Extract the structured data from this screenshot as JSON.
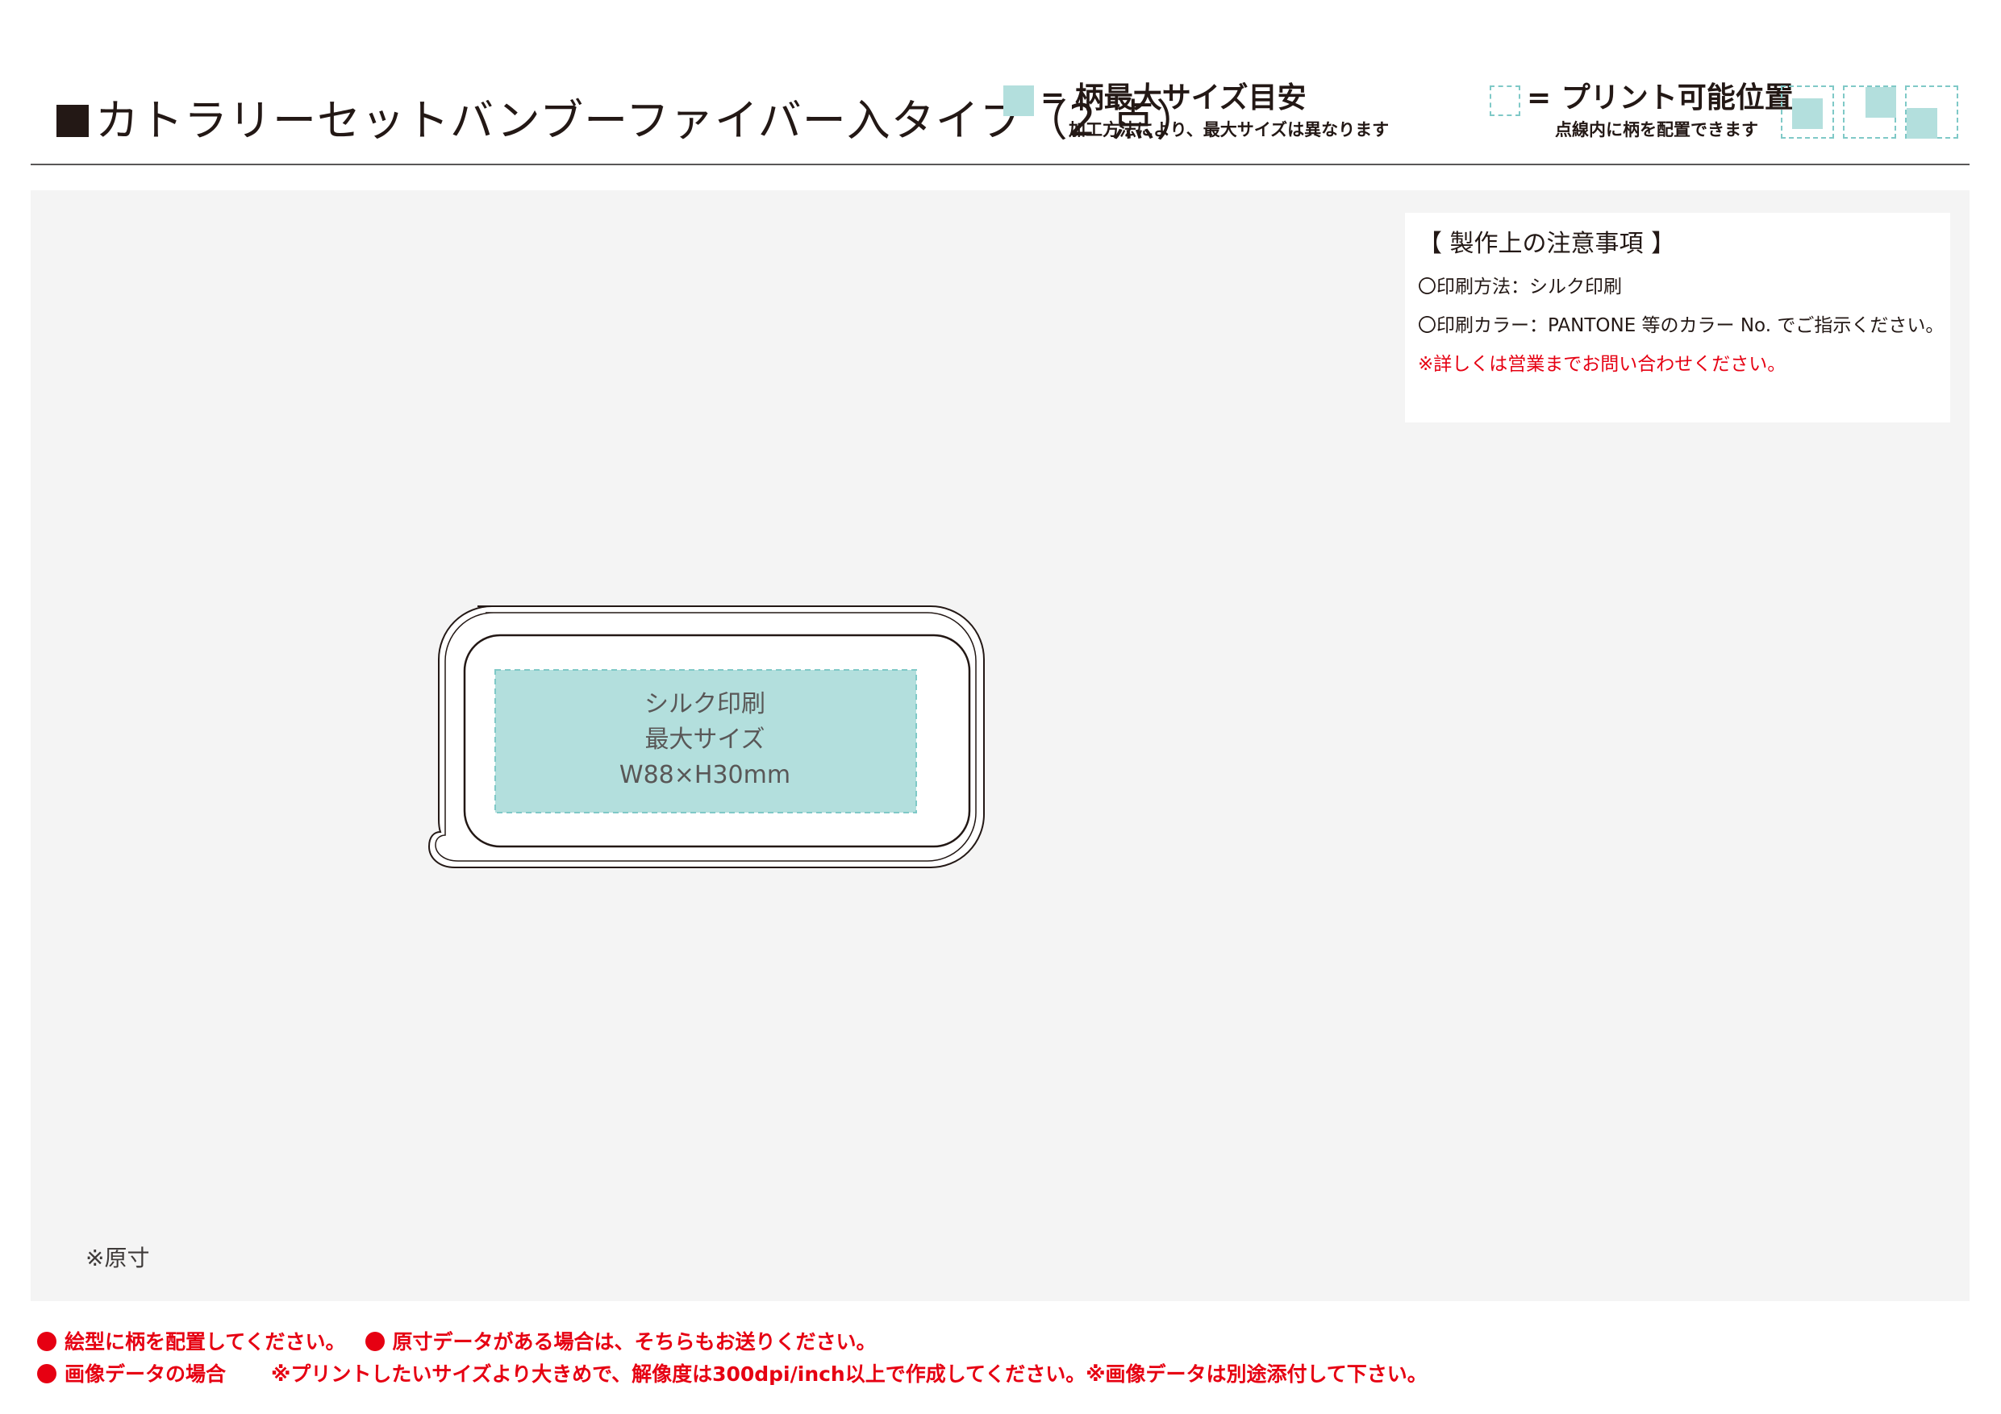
{
  "header": {
    "title": "カトラリーセットバンブーファイバー入タイプ（2 点）"
  },
  "legend_max_size": {
    "title": "= 柄最大サイズ目安",
    "note": "加工方法により、最大サイズは異なります",
    "swatch_color": "#b3dfdd"
  },
  "legend_print_position": {
    "title": "= プリント可能位置",
    "note": "点線内に柄を配置できます",
    "dash_color": "#7fc9c7"
  },
  "notes": {
    "heading": "【 製作上の注意事項 】",
    "lines": [
      "〇印刷方法：シルク印刷",
      "〇印刷カラー：PANTONE 等のカラー No. でご指示ください。",
      "※詳しくは営業までお問い合わせください。"
    ]
  },
  "print_area": {
    "lines": [
      "シルク印刷",
      "最大サイズ",
      "W88×H30mm"
    ]
  },
  "scale_note": "※原寸",
  "footer": {
    "line1_a": "絵型に柄を配置してください。",
    "line1_b": "原寸データがある場合は、そちらもお送りください。",
    "line2_a": "画像データの場合",
    "line2_b": "※プリントしたいサイズより大きめで、解像度は300dpi/inch以上で作成してください。※画像データは別途添付して下さい。"
  },
  "colors": {
    "accent_red": "#e60012",
    "print_fill": "#b3dfdd",
    "print_dash": "#7fc9c7",
    "background": "#f4f4f4"
  }
}
